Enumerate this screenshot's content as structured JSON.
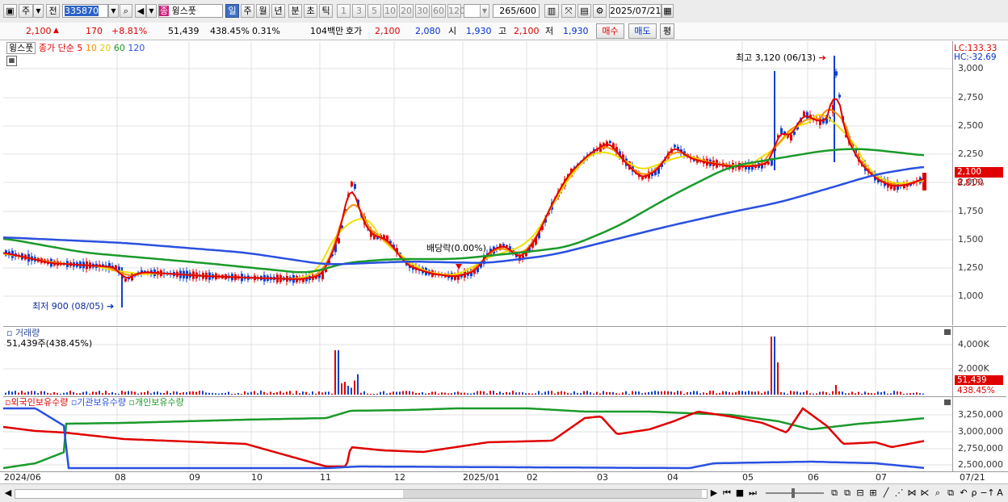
{
  "toolbar": {
    "market_select": "주",
    "prev_label": "전",
    "code": "335870",
    "stock_badge": "종",
    "stock_name": "윙스풋",
    "periods": [
      "일",
      "주",
      "월",
      "년",
      "분",
      "초",
      "틱"
    ],
    "intervals": [
      "1",
      "3",
      "5",
      "10",
      "20",
      "30",
      "60",
      "120"
    ],
    "count": "265",
    "count_max": "/600",
    "date": "2025/07/21"
  },
  "quote": {
    "price": "2,100",
    "arrow": "▲",
    "change": "170",
    "change_pct": "+8.81%",
    "volume": "51,439",
    "volume_ratio": "438.45%",
    "turnover": "0.31%",
    "amount": "104백만",
    "bid_label": "호가",
    "bid": "2,100",
    "ask": "2,080",
    "open_label": "시",
    "open": "1,930",
    "high_label": "고",
    "high": "2,100",
    "low_label": "저",
    "low": "1,930",
    "buy_label": "매수",
    "sell_label": "매도",
    "eval_label": "평"
  },
  "legend": {
    "name": "윙스풋",
    "close_label": "종가 단순",
    "ma5": "5",
    "ma10": "10",
    "ma20": "20",
    "ma60": "60",
    "ma120": "120",
    "lc": "LC:133.33",
    "hc": "HC:-32.69",
    "high_note": "최고 3,120 (06/13)",
    "low_note": "최저 900 (08/05)",
    "dividend_note": "배당락(0.00%)",
    "price_tag": "2,100",
    "pct_tag": "8.81%"
  },
  "price_axis": [
    "3,000",
    "2,750",
    "2,500",
    "2,250",
    "2,000",
    "1,750",
    "1,500",
    "1,250",
    "1,000"
  ],
  "volume_pane": {
    "title": "거래량",
    "value": "51,439주(438.45%)",
    "axis": [
      "4,000K",
      "2,000K"
    ],
    "tag_value": "51,439",
    "tag_pct": "438.45%"
  },
  "holding_pane": {
    "legend": [
      "외국인보유수량",
      "기관보유수량",
      "개인보유수량"
    ],
    "axis": [
      "3,250,000",
      "3,000,000",
      "2,750,000",
      "2,500,000"
    ]
  },
  "x_axis": [
    "2024/06",
    "08",
    "09",
    "10",
    "11",
    "12",
    "2025/01",
    "02",
    "03",
    "04",
    "05",
    "06",
    "07",
    "07/21"
  ],
  "colors": {
    "ma5": "#e00000",
    "ma10": "#ff8c00",
    "ma20": "#f0e000",
    "ma60": "#1a9a2a",
    "ma120": "#2a50e0",
    "up": "#e00000",
    "down": "#1040d0"
  }
}
